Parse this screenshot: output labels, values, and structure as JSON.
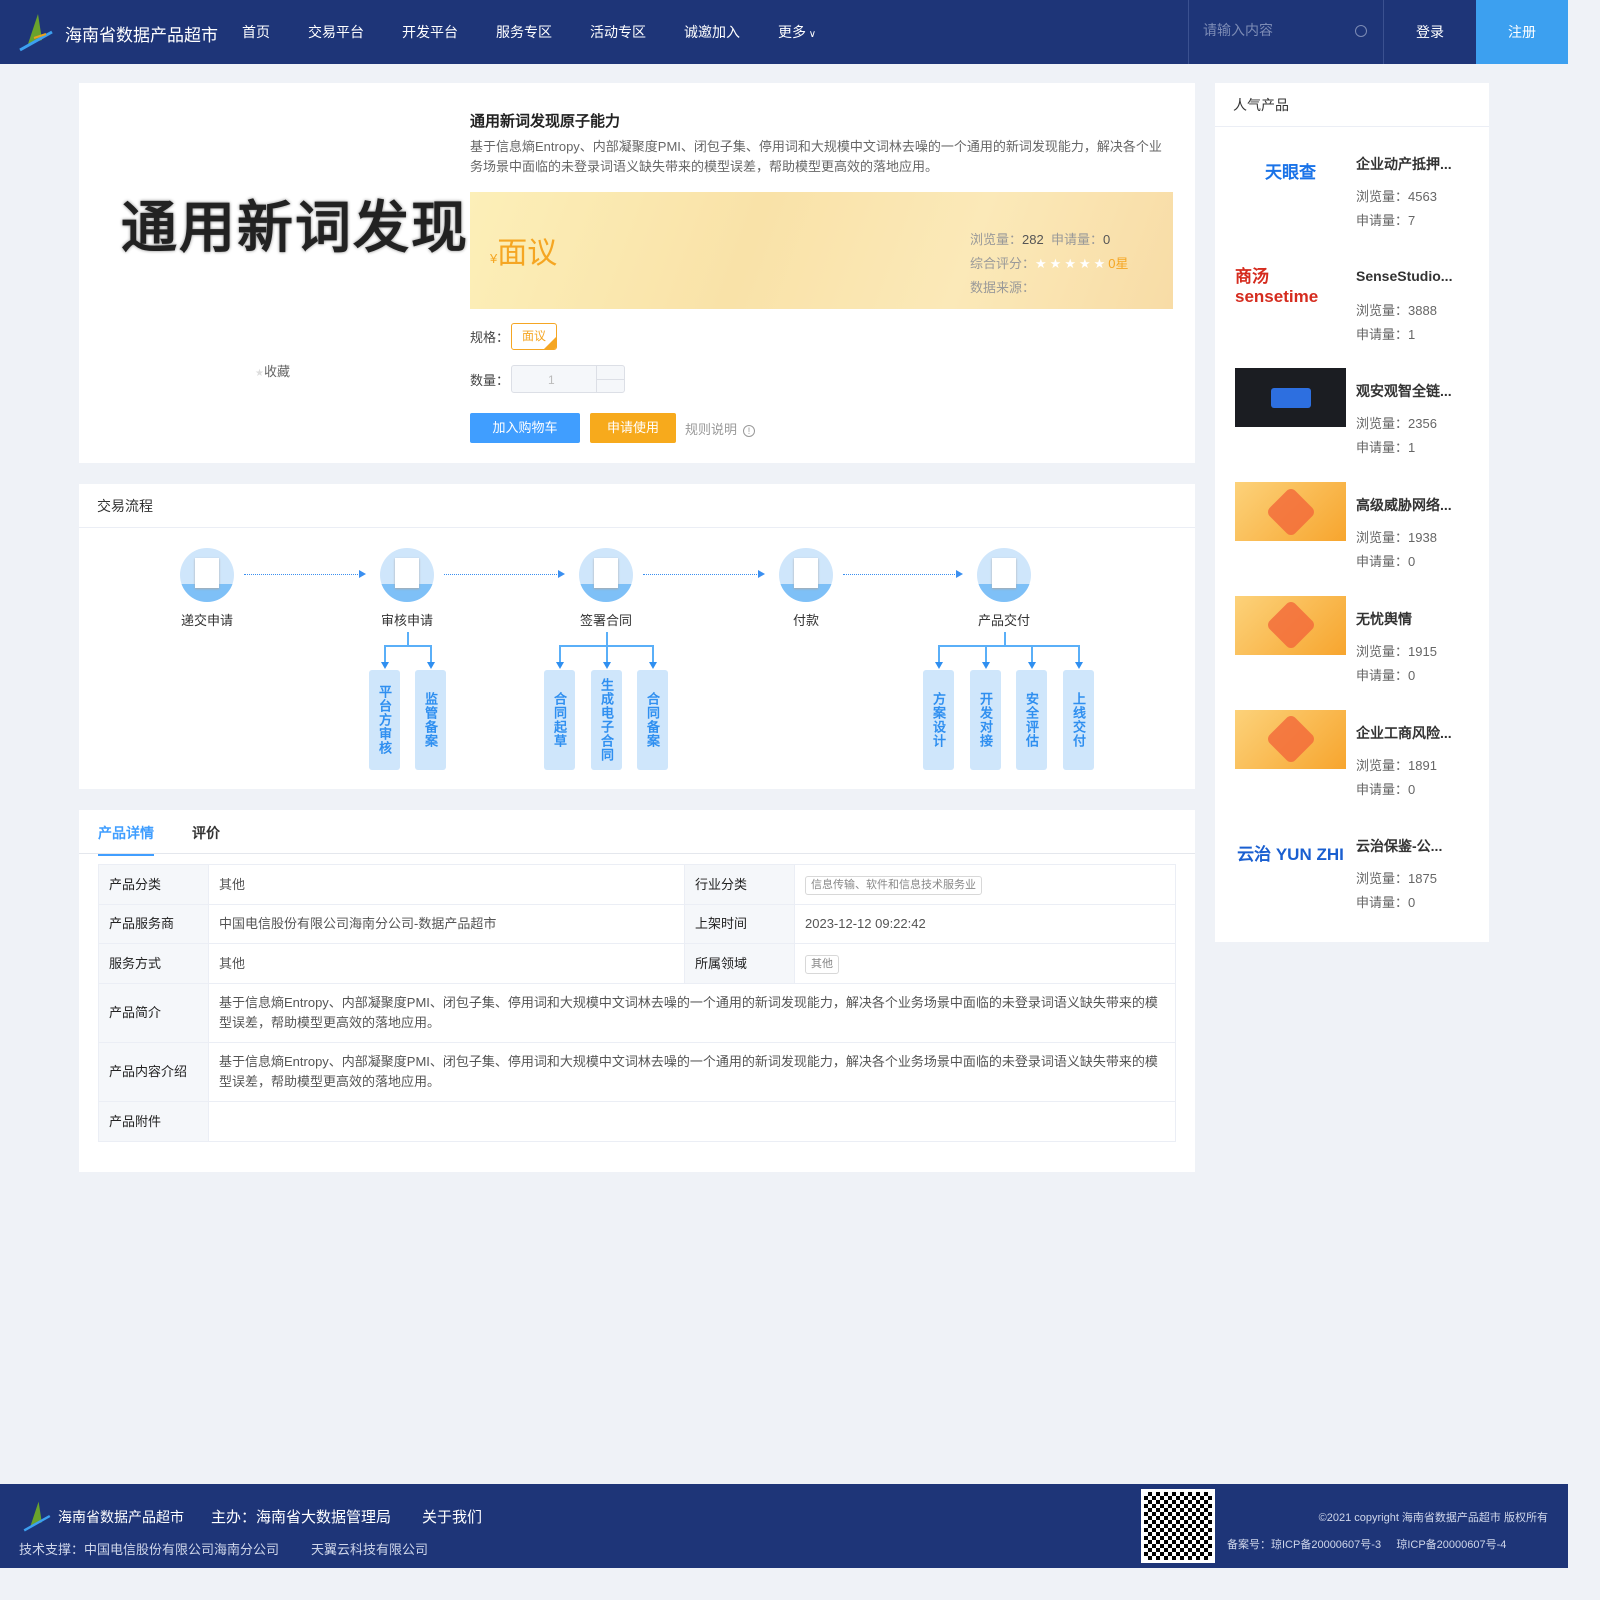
{
  "header": {
    "brand": "海南省数据产品超市",
    "nav": [
      "首页",
      "交易平台",
      "开发平台",
      "服务专区",
      "活动专区",
      "诚邀加入",
      "更多"
    ],
    "search_placeholder": "请输入内容",
    "login": "登录",
    "register": "注册"
  },
  "product": {
    "cover_text": "通用新词发现",
    "favorite": "收藏",
    "title": "通用新词发现原子能力",
    "description": "基于信息熵Entropy、内部凝聚度PMI、闭包子集、停用词和大规模中文词林去噪的一个通用的新词发现能力，解决各个业务场景中面临的未登录词语义缺失带来的模型误差，帮助模型更高效的落地应用。",
    "currency": "¥",
    "price": "面议",
    "views_label": "浏览量：",
    "views": "282",
    "applies_label": "申请量：",
    "applies": "0",
    "rating_label": "综合评分：",
    "rating": "0星",
    "rating_value": 0,
    "source_label": "数据来源：",
    "spec_label": "规格：",
    "spec": "面议",
    "qty_label": "数量：",
    "qty": "1",
    "add_cart": "加入购物车",
    "apply": "申请使用",
    "rules": "规则说明"
  },
  "flow": {
    "title": "交易流程",
    "steps": [
      {
        "label": "递交申请",
        "subs": []
      },
      {
        "label": "审核申请",
        "subs": [
          "平台方审核",
          "监管备案"
        ]
      },
      {
        "label": "签署合同",
        "subs": [
          "合同起草",
          "生成电子合同",
          "合同备案"
        ]
      },
      {
        "label": "付款",
        "subs": []
      },
      {
        "label": "产品交付",
        "subs": [
          "方案设计",
          "开发对接",
          "安全评估",
          "上线交付"
        ]
      }
    ]
  },
  "details": {
    "tabs": [
      "产品详情",
      "评价"
    ],
    "rows": [
      [
        {
          "k": "产品分类",
          "v": "其他"
        },
        {
          "k": "行业分类",
          "v": "信息传输、软件和信息技术服务业",
          "tag": true
        }
      ],
      [
        {
          "k": "产品服务商",
          "v": "中国电信股份有限公司海南分公司-数据产品超市"
        },
        {
          "k": "上架时间",
          "v": "2023-12-12 09:22:42"
        }
      ],
      [
        {
          "k": "服务方式",
          "v": "其他"
        },
        {
          "k": "所属领域",
          "v": "其他",
          "tag": true
        }
      ],
      [
        {
          "k": "产品简介",
          "v": "基于信息熵Entropy、内部凝聚度PMI、闭包子集、停用词和大规模中文词林去噪的一个通用的新词发现能力，解决各个业务场景中面临的未登录词语义缺失带来的模型误差，帮助模型更高效的落地应用。"
        }
      ],
      [
        {
          "k": "产品内容介绍",
          "v": "基于信息熵Entropy、内部凝聚度PMI、闭包子集、停用词和大规模中文词林去噪的一个通用的新词发现能力，解决各个业务场景中面临的未登录词语义缺失带来的模型误差，帮助模型更高效的落地应用。"
        }
      ],
      [
        {
          "k": "产品附件",
          "v": ""
        }
      ]
    ]
  },
  "popular": {
    "title": "人气产品",
    "views_label": "浏览量：",
    "applies_label": "申请量：",
    "items": [
      {
        "name": "企业动产抵押...",
        "views": "4563",
        "applies": "7",
        "logo": "天眼查",
        "bg": "#ffffff",
        "fg": "#1a73e8"
      },
      {
        "name": "SenseStudio...",
        "views": "3888",
        "applies": "1",
        "logo": "商汤 sensetime",
        "bg": "#ffffff",
        "fg": "#d52b1e"
      },
      {
        "name": "观安观智全链...",
        "views": "2356",
        "applies": "1",
        "logo": "",
        "bg": "#1b1d22",
        "fg": "#fff"
      },
      {
        "name": "高级威胁网络...",
        "views": "1938",
        "applies": "0",
        "logo": "",
        "bg": "#f9b642",
        "fg": "#fff"
      },
      {
        "name": "无忧舆情",
        "views": "1915",
        "applies": "0",
        "logo": "",
        "bg": "#f9b642",
        "fg": "#fff"
      },
      {
        "name": "企业工商风险...",
        "views": "1891",
        "applies": "0",
        "logo": "",
        "bg": "#f9b642",
        "fg": "#fff"
      },
      {
        "name": "云治保鉴-公...",
        "views": "1875",
        "applies": "0",
        "logo": "云治 YUN ZHI",
        "bg": "#ffffff",
        "fg": "#1a5fd0"
      }
    ]
  },
  "footer": {
    "brand": "海南省数据产品超市",
    "host": "主办：海南省大数据管理局",
    "about": "关于我们",
    "support": "技术支撑：中国电信股份有限公司海南分公司",
    "support2": "天翼云科技有限公司",
    "copyright": "©2021 copyright 海南省数据产品超市 版权所有",
    "icp_label": "备案号：",
    "icp1": "琼ICP备20000607号-3",
    "icp2": "琼ICP备20000607号-4"
  }
}
